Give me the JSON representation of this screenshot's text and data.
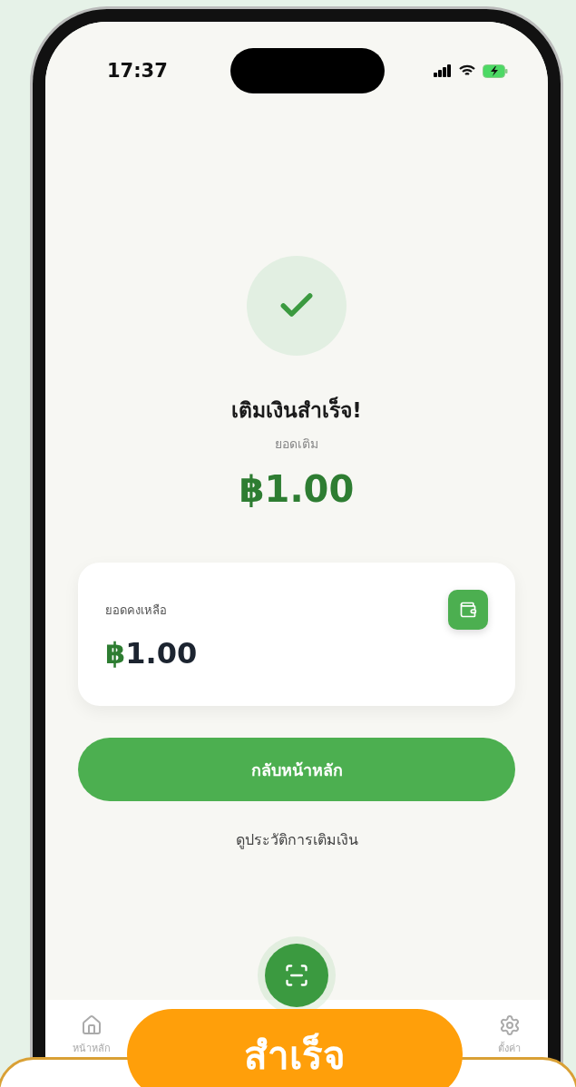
{
  "status_bar": {
    "time": "17:37"
  },
  "result": {
    "title": "เติมเงินสำเร็จ!",
    "amount_label": "ยอดเติม",
    "currency": "฿",
    "amount": "1.00"
  },
  "balance_card": {
    "label": "ยอดคงเหลือ",
    "currency": "฿",
    "amount": "1.00"
  },
  "primary_button": "กลับหน้าหลัก",
  "history_link": "ดูประวัติการเติมเงิน",
  "nav": [
    {
      "label": "หน้าหลัก",
      "kind": "home"
    },
    {
      "label": "ตั้งค่า",
      "kind": "settings"
    }
  ],
  "banner": {
    "label": "สำเร็จ"
  }
}
